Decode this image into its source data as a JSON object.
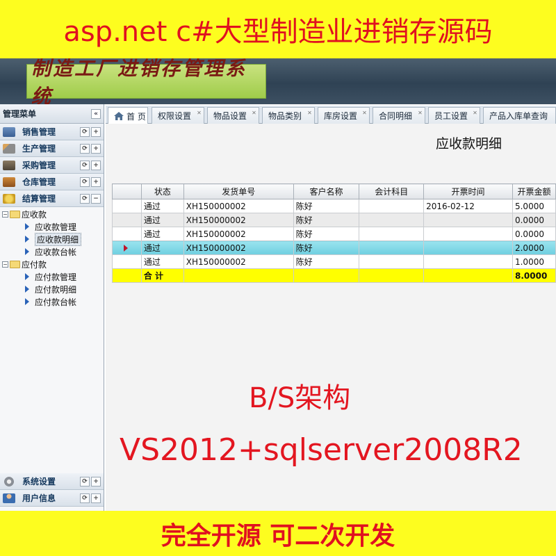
{
  "promo": {
    "top_text": "asp.net c#大型制造业进销存源码",
    "arch_text": "B/S架构",
    "stack_text": "VS2012+sqlserver2008R2",
    "bottom_text": "完全开源 可二次开发"
  },
  "header": {
    "logo_text": "制造工厂进销存管理系统"
  },
  "sidebar": {
    "title": "管理菜单",
    "collapse_glyph": "«",
    "groups": [
      {
        "label": "销售管理",
        "icon": "sales-icon"
      },
      {
        "label": "生产管理",
        "icon": "wrench-icon"
      },
      {
        "label": "采购管理",
        "icon": "truck-icon"
      },
      {
        "label": "仓库管理",
        "icon": "warehouse-icon"
      },
      {
        "label": "结算管理",
        "icon": "coins-icon"
      }
    ],
    "tree": {
      "receivable": {
        "label": "应收款",
        "children": [
          "应收款管理",
          "应收款明细",
          "应收款台帐"
        ]
      },
      "payable": {
        "label": "应付款",
        "children": [
          "应付款管理",
          "应付款明细",
          "应付款台帐"
        ]
      }
    },
    "bottom_groups": [
      {
        "label": "系统设置",
        "icon": "gear-icon"
      },
      {
        "label": "用户信息",
        "icon": "user-icon"
      }
    ]
  },
  "tabs": [
    "首 页",
    "权限设置",
    "物品设置",
    "物品类别",
    "库房设置",
    "合同明细",
    "员工设置",
    "产品入库单查询"
  ],
  "content": {
    "title": "应收款明细",
    "columns": [
      "状态",
      "发货单号",
      "客户名称",
      "会计科目",
      "开票时间",
      "开票金额"
    ],
    "rows": [
      [
        "通过",
        "XH150000002",
        "陈好",
        "",
        "2016-02-12",
        "5.0000"
      ],
      [
        "通过",
        "XH150000002",
        "陈好",
        "",
        "",
        "0.0000"
      ],
      [
        "通过",
        "XH150000002",
        "陈好",
        "",
        "",
        "0.0000"
      ],
      [
        "通过",
        "XH150000002",
        "陈好",
        "",
        "",
        "2.0000"
      ],
      [
        "通过",
        "XH150000002",
        "陈好",
        "",
        "",
        "1.0000"
      ]
    ],
    "total": {
      "label": "合 计",
      "amount": "8.0000"
    }
  },
  "colors": {
    "banner_bg": "#fdfd1f",
    "promo_red": "#e01020",
    "selected_row": "#8adcea",
    "total_row": "#ffff00"
  }
}
